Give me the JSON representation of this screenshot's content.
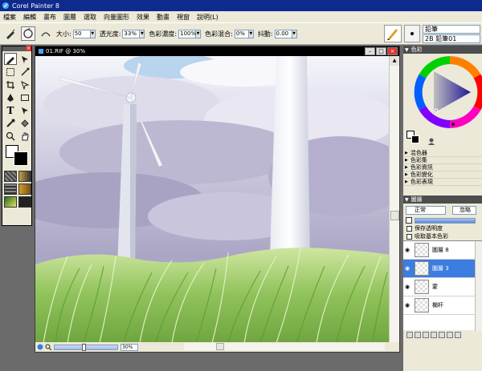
{
  "app": {
    "title": "Corel Painter 8"
  },
  "menu": [
    "檔案",
    "編輯",
    "畫布",
    "圖層",
    "選取",
    "向量圖形",
    "效果",
    "動畫",
    "視窗",
    "說明(L)"
  ],
  "propbar": {
    "size_label": "大小:",
    "size_value": "50",
    "opacity_label": "透光度:",
    "opacity_value": "33%",
    "color_depth_label": "色彩濃度:",
    "color_depth_value": "100%",
    "color_mix_label": "色彩混合:",
    "color_mix_value": "0%",
    "jitter_label": "抖動:",
    "jitter_value": "0.00"
  },
  "brush_selector": {
    "category": "鉛筆",
    "variant": "2B 鉛筆01"
  },
  "document": {
    "title": "01.RIF @ 30%",
    "zoom_value": "30%"
  },
  "palettes": {
    "color_title": "色彩",
    "collapsed": [
      "混色器",
      "色彩集",
      "色彩資訊",
      "色彩變化",
      "色彩表現"
    ]
  },
  "layers": {
    "title": "圖層",
    "blend_mode": "正常",
    "composite": "忽略",
    "preserve_transparency": "保存透明度",
    "pick_up_color": "吸取基本色彩",
    "items": [
      {
        "name": "圖層 8",
        "visible": true,
        "selected": false
      },
      {
        "name": "圖層 3",
        "visible": true,
        "selected": true
      },
      {
        "name": "蒙",
        "visible": true,
        "selected": false
      },
      {
        "name": "欄杆",
        "visible": true,
        "selected": false
      }
    ]
  },
  "colors": {
    "titlebar": "#0d2a8c",
    "selected_layer": "#3b7de0",
    "sky_purple": "#a7a3c4",
    "grass_green": "#8fc25a"
  }
}
